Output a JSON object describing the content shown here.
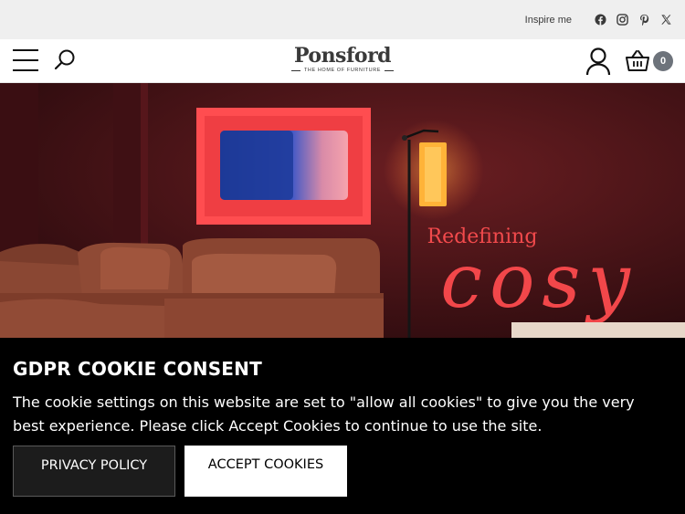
{
  "topbar": {
    "inspire_label": "Inspire me",
    "social": [
      "facebook-icon",
      "instagram-icon",
      "pinterest-icon",
      "x-icon"
    ]
  },
  "header": {
    "logo_name": "Ponsford",
    "logo_tagline": "THE HOME OF FURNITURE",
    "basket_count": "0"
  },
  "hero": {
    "headline": "Redefining",
    "script_word": "cosy",
    "colors": {
      "wall": "#4a1418",
      "sofa": "#8a4733",
      "accent": "#f2474a"
    }
  },
  "cookie_banner": {
    "title": "GDPR COOKIE CONSENT",
    "body": "The cookie settings on this website are set to \"allow all cookies\" to give you the very best experience. Please click Accept Cookies to continue to use the site.",
    "privacy_label": "PRIVACY POLICY",
    "accept_label": "ACCEPT COOKIES"
  }
}
